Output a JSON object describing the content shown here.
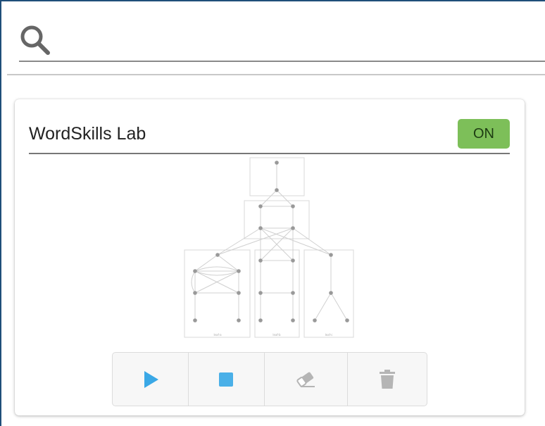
{
  "search": {
    "icon": "search-icon",
    "placeholder": "",
    "value": ""
  },
  "card": {
    "title": "WordSkills Lab",
    "status": "ON",
    "status_color": "#7dbf59",
    "topology": {
      "group_labels": [
        "leaf-a",
        "leaf-b",
        "leaf-c"
      ]
    },
    "actions": [
      {
        "icon": "play-icon",
        "color": "#3aa8e6"
      },
      {
        "icon": "stop-icon",
        "color": "#4ab0e8"
      },
      {
        "icon": "eraser-icon",
        "color": "#b5b5b5"
      },
      {
        "icon": "trash-icon",
        "color": "#b5b5b5"
      }
    ]
  },
  "colors": {
    "frame_border": "#1f4e79",
    "accent_blue": "#3aa8e6",
    "muted_gray": "#b5b5b5"
  }
}
